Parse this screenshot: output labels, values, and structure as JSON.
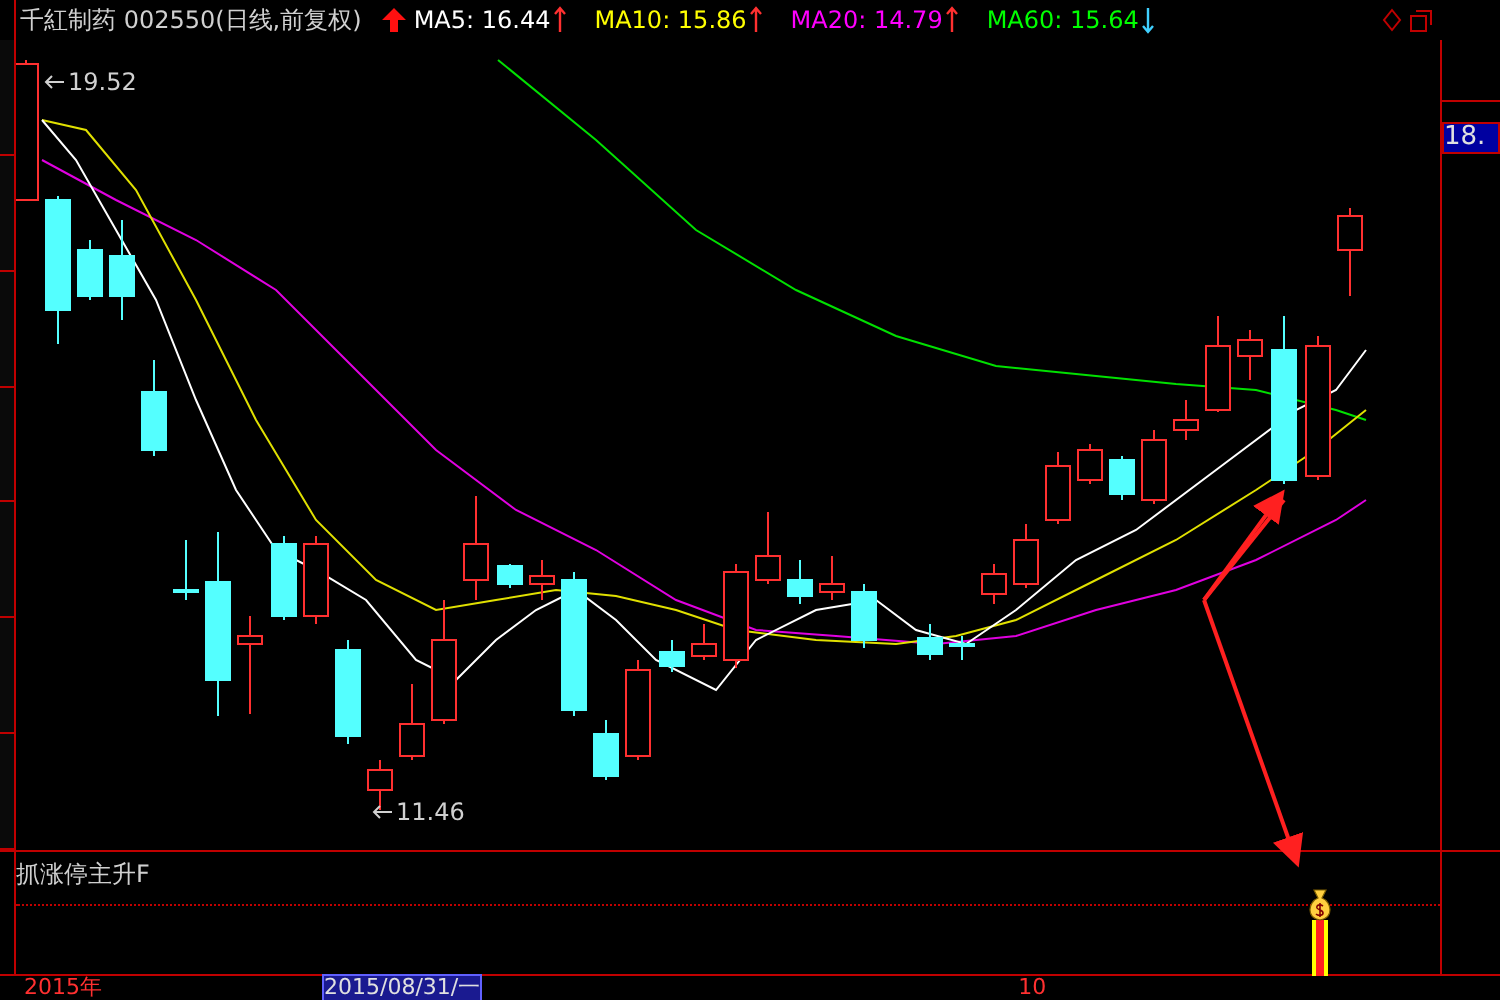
{
  "header": {
    "title": "千紅制药 002550(日线,前复权)",
    "indicators": [
      {
        "label": "MA5: 16.44",
        "color": "#ffffff",
        "rising": true
      },
      {
        "label": "MA10: 15.86",
        "color": "#ffff00",
        "rising": true
      },
      {
        "label": "MA20: 14.79",
        "color": "#ff00ff",
        "rising": true
      },
      {
        "label": "MA60: 15.64",
        "color": "#00ff00",
        "rising": false
      }
    ]
  },
  "chart": {
    "high_label": "19.52",
    "low_label": "11.46"
  },
  "price_axis": {
    "current_price": "18."
  },
  "indicator_panel": {
    "title": "抓涨停主升F"
  },
  "date_axis": {
    "labels": [
      {
        "text": "2015年",
        "selected": false
      },
      {
        "text": "2015/08/31/一",
        "selected": true
      },
      {
        "text": "10",
        "selected": false
      }
    ]
  }
}
